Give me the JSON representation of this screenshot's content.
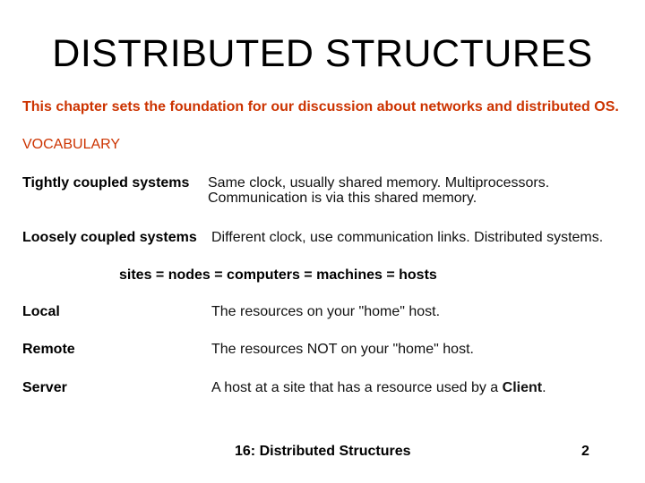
{
  "slide": {
    "title": "DISTRIBUTED  STRUCTURES",
    "intro": "This chapter sets the foundation for our discussion about networks and distributed OS.",
    "section_heading": "VOCABULARY",
    "colors": {
      "accent": "#cc3300",
      "text": "#000000",
      "background": "#ffffff"
    },
    "definitions": [
      {
        "term": "Tightly coupled systems",
        "lines": [
          "Same clock, usually shared memory. Multiprocessors.",
          "Communication is via this shared memory."
        ]
      },
      {
        "term": "Loosely coupled systems",
        "lines": [
          "Different clock, use communication links. Distributed systems."
        ]
      }
    ],
    "synonyms": "sites = nodes = computers = machines = hosts",
    "roles": [
      {
        "term": "Local",
        "definition": "The  resources on your \"home\" host."
      },
      {
        "term": "Remote",
        "definition": "The  resources NOT on your \"home\" host."
      },
      {
        "term": "Server",
        "definition_prefix": "A host at a site that has a resource used by a ",
        "definition_bold": "Client",
        "definition_suffix": "."
      }
    ],
    "footer": {
      "label": "16: Distributed Structures",
      "page_number": "2"
    }
  }
}
